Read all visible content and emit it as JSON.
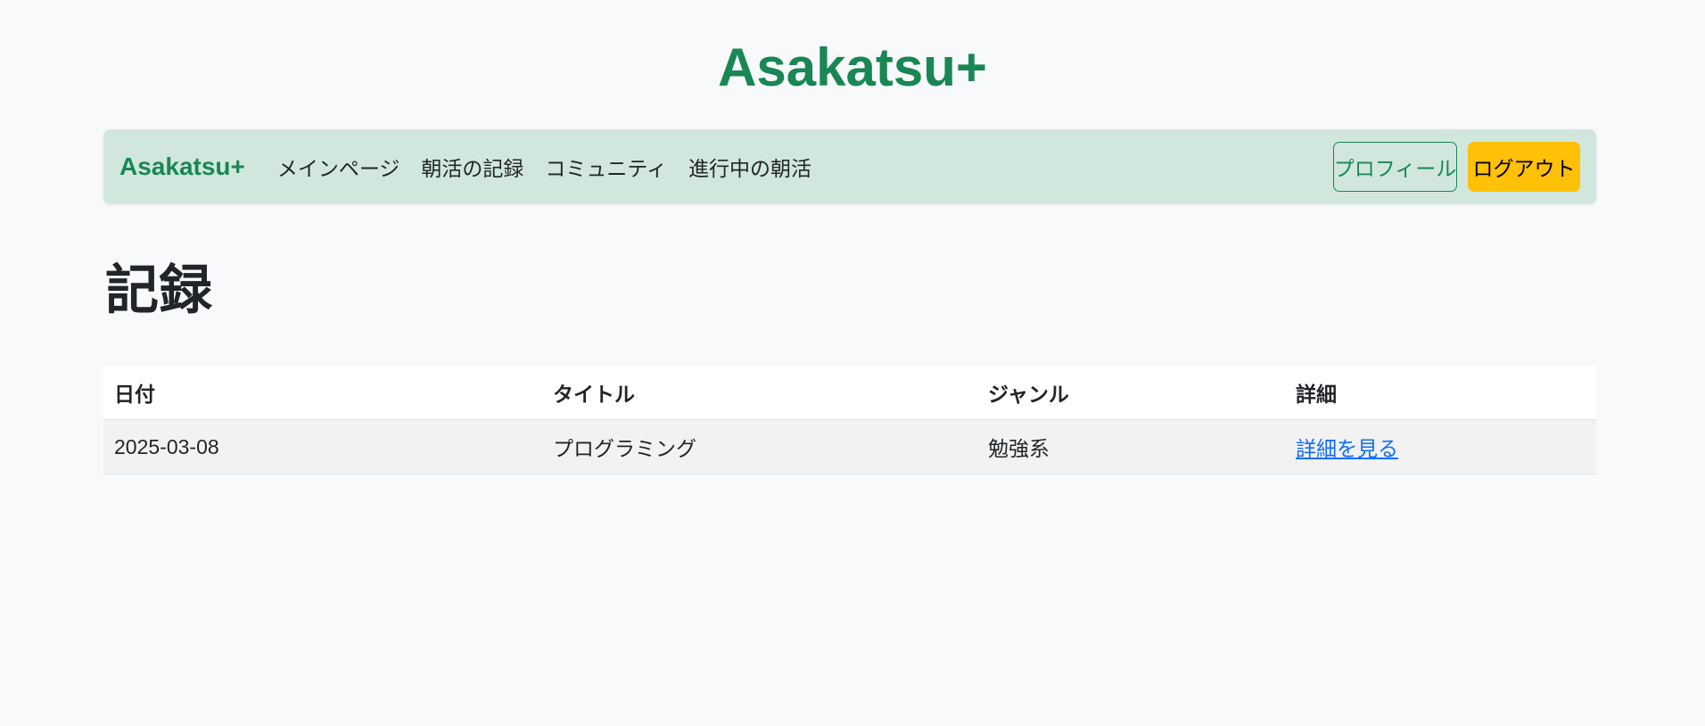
{
  "site_title": "Asakatsu+",
  "navbar": {
    "brand": "Asakatsu+",
    "links": [
      "メインページ",
      "朝活の記録",
      "コミュニティ",
      "進行中の朝活"
    ],
    "profile_label": "プロフィール",
    "logout_label": "ログアウト"
  },
  "page_heading": "記録",
  "table": {
    "headers": [
      "日付",
      "タイトル",
      "ジャンル",
      "詳細"
    ],
    "rows": [
      {
        "date": "2025-03-08",
        "title": "プログラミング",
        "genre": "勉強系",
        "detail_link": "詳細を見る"
      }
    ]
  },
  "colors": {
    "brand_green": "#198754",
    "navbar_bg": "#d1e7dd",
    "logout_yellow": "#ffc107",
    "link_blue": "#0d6efd",
    "page_bg": "#f8f9fa"
  }
}
